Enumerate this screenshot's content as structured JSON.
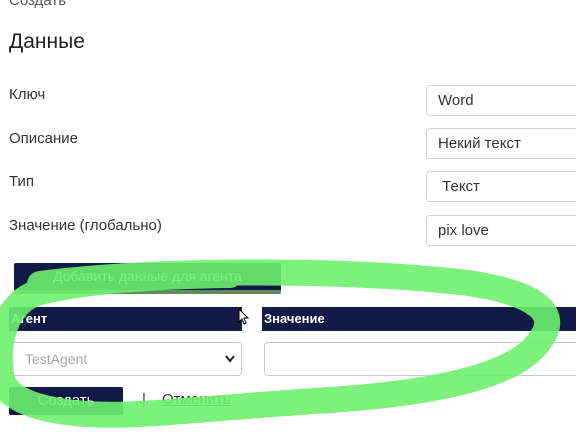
{
  "page": {
    "top_cut_text": "Создать",
    "title": "Данные"
  },
  "form": {
    "fields": [
      {
        "label": "Ключ",
        "value": "Word"
      },
      {
        "label": "Описание",
        "value": "Некий текст"
      },
      {
        "label": "Тип",
        "value": " Текст"
      },
      {
        "label": "Значение (глобально)",
        "value": "pix love"
      }
    ]
  },
  "agents": {
    "add_button": "Добавить данные для агента",
    "columns": [
      "Агент",
      "Значение"
    ],
    "agent_select_value": "TestAgent",
    "value_input": ""
  },
  "actions": {
    "create": "Создать",
    "separator": "|",
    "cancel": "Отменить"
  },
  "colors": {
    "primary": "#121a47",
    "annotation": "#6ef06e"
  },
  "icons": {
    "select": "chevron-down-icon",
    "pointer": "mouse-cursor-icon"
  }
}
